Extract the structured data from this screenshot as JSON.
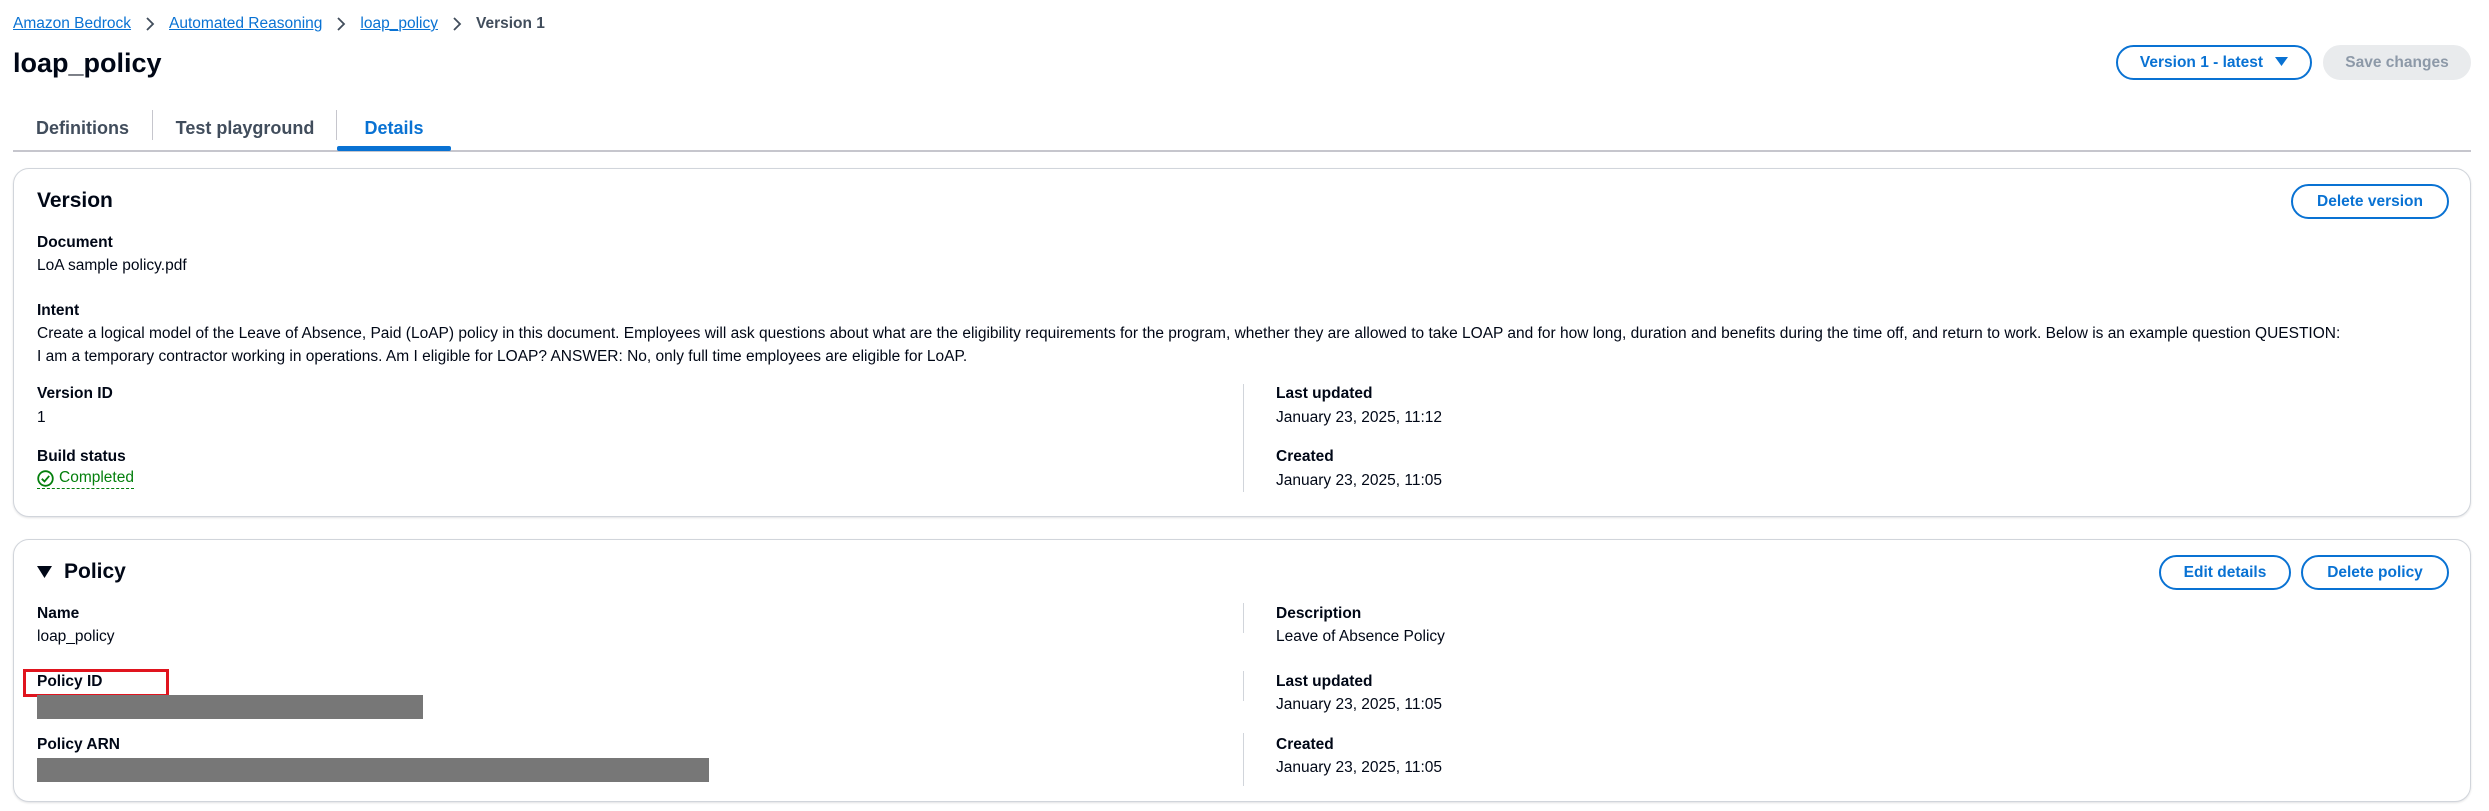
{
  "breadcrumb": {
    "items": [
      "Amazon Bedrock",
      "Automated Reasoning",
      "loap_policy"
    ],
    "current": "Version 1"
  },
  "page": {
    "title": "loap_policy",
    "version_select": "Version 1 - latest",
    "save_label": "Save changes"
  },
  "tabs": [
    "Definitions",
    "Test playground",
    "Details"
  ],
  "active_tab": "Details",
  "version_section": {
    "title": "Version",
    "delete_label": "Delete version",
    "document_label": "Document",
    "document_value": "LoA sample policy.pdf",
    "intent_label": "Intent",
    "intent_line1": "Create a logical model of the Leave of Absence, Paid (LoAP) policy in this document. Employees will ask questions about what are the eligibility requirements for the program, whether they are allowed to take LOAP and for how long, duration and benefits during the time off, and return to work. Below is an example question QUESTION:",
    "intent_line2": "I am a temporary contractor working in operations. Am I eligible for LOAP? ANSWER: No, only full time employees are eligible for LoAP.",
    "version_id_label": "Version ID",
    "version_id_value": "1",
    "build_status_label": "Build status",
    "build_status_value": "Completed",
    "last_updated_label": "Last updated",
    "last_updated_value": "January 23, 2025, 11:12",
    "created_label": "Created",
    "created_value": "January 23, 2025, 11:05"
  },
  "policy_section": {
    "title": "Policy",
    "edit_label": "Edit details",
    "delete_label": "Delete policy",
    "name_label": "Name",
    "name_value": "loap_policy",
    "policy_id_label": "Policy ID",
    "policy_arn_label": "Policy ARN",
    "description_label": "Description",
    "description_value": "Leave of Absence Policy",
    "last_updated_label": "Last updated",
    "last_updated_value": "January 23, 2025, 11:05",
    "created_label": "Created",
    "created_value": "January 23, 2025, 11:05"
  },
  "colors": {
    "link": "#0972d3",
    "success": "#037f0c",
    "highlight": "#e0141e",
    "redaction": "#777777"
  },
  "icons": [
    "chevron-right-icon",
    "caret-down-icon",
    "check-circle-icon",
    "collapse-triangle-icon"
  ]
}
